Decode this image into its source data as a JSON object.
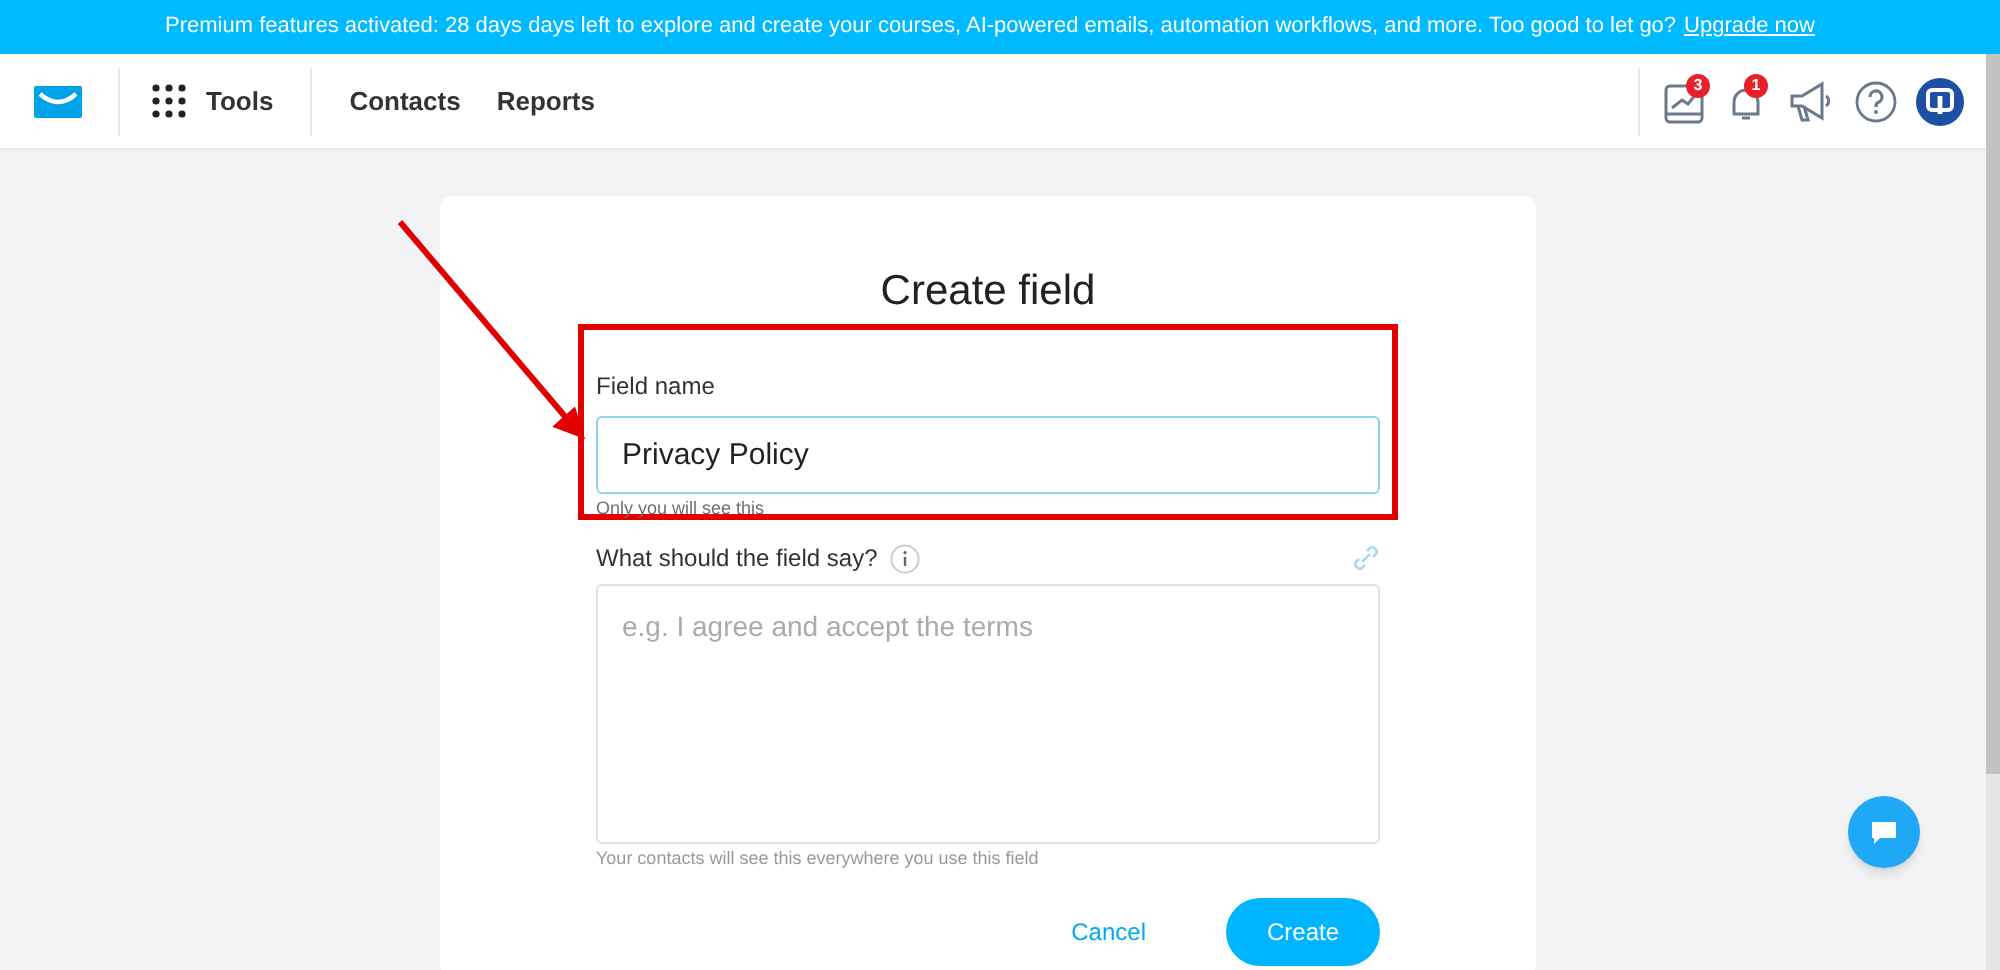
{
  "banner": {
    "text": "Premium features activated: 28 days days left to explore and create your courses, AI-powered emails, automation workflows, and more. Too good to let go?",
    "link": "Upgrade now"
  },
  "nav": {
    "tools": "Tools",
    "items": [
      "Contacts",
      "Reports"
    ],
    "badges": {
      "tasks": "3",
      "notifications": "1"
    }
  },
  "dialog": {
    "title": "Create field",
    "field_name": {
      "label": "Field name",
      "value": "Privacy Policy",
      "hint": "Only you will see this"
    },
    "field_text": {
      "label": "What should the field say?",
      "placeholder": "e.g. I agree and accept the terms",
      "hint": "Your contacts will see this everywhere you use this field"
    },
    "buttons": [
      "Cancel",
      "Create"
    ]
  }
}
